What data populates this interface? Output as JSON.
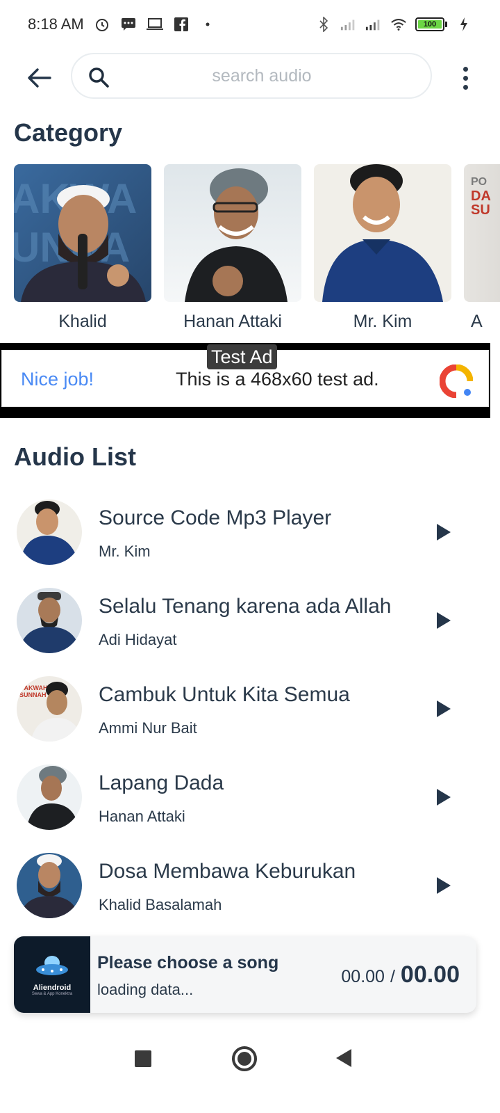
{
  "status_bar": {
    "time": "8:18 AM",
    "battery": "100",
    "left_icons": [
      "alarm-icon",
      "message-icon",
      "laptop-icon",
      "facebook-icon",
      "dot-icon"
    ],
    "right_icons": [
      "bluetooth-icon",
      "signal-icon",
      "signal-icon",
      "wifi-icon",
      "battery-icon",
      "charging-icon"
    ]
  },
  "top_bar": {
    "search_placeholder": "search audio"
  },
  "category": {
    "title": "Category",
    "items": [
      {
        "label": "Khalid"
      },
      {
        "label": "Hanan Attaki"
      },
      {
        "label": "Mr. Kim"
      },
      {
        "label": "A"
      }
    ]
  },
  "ad": {
    "tag": "Test Ad",
    "headline": "Nice job!",
    "text": "This is a 468x60 test ad.",
    "accent": "#4a8af4"
  },
  "audio_list": {
    "title": "Audio List",
    "items": [
      {
        "title": "Source Code Mp3 Player",
        "artist": "Mr. Kim"
      },
      {
        "title": "Selalu Tenang karena ada Allah",
        "artist": "Adi Hidayat"
      },
      {
        "title": "Cambuk Untuk Kita Semua",
        "artist": "Ammi Nur Bait"
      },
      {
        "title": "Lapang Dada",
        "artist": "Hanan Attaki"
      },
      {
        "title": "Dosa Membawa Keburukan",
        "artist": "Khalid Basalamah"
      }
    ]
  },
  "player": {
    "art_label": "Aliendroid",
    "art_sub": "Sewa & App Konektra",
    "title": "Please choose a song",
    "status": "loading data...",
    "current_time": "00.00",
    "separator": "/",
    "total_time": "00.00"
  }
}
